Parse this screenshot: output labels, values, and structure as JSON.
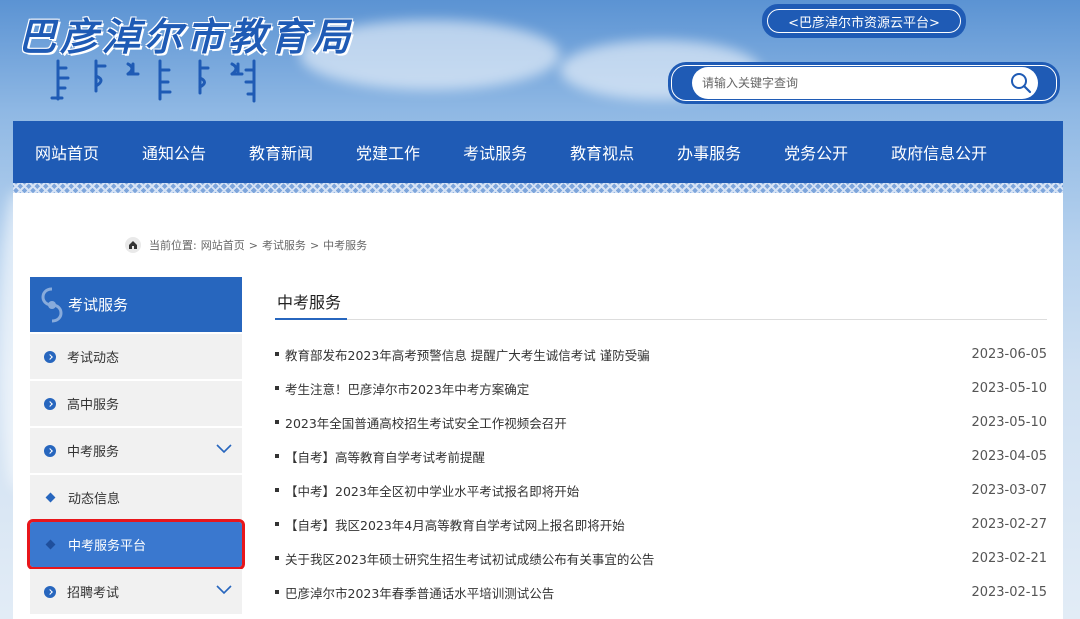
{
  "header": {
    "site_title": "巴彦淖尔市教育局",
    "cloud_platform_link": "<巴彦淖尔市资源云平台>",
    "search": {
      "placeholder": "请输入关键字查询"
    }
  },
  "nav": {
    "items": [
      "网站首页",
      "通知公告",
      "教育新闻",
      "党建工作",
      "考试服务",
      "教育视点",
      "办事服务",
      "党务公开",
      "政府信息公开"
    ]
  },
  "breadcrumb": {
    "prefix": "当前位置:",
    "items": [
      "网站首页",
      "考试服务",
      "中考服务"
    ],
    "separator": ">"
  },
  "sidebar": {
    "heading": "考试服务",
    "items": [
      {
        "label": "考试动态"
      },
      {
        "label": "高中服务"
      },
      {
        "label": "中考服务"
      },
      {
        "label": "动态信息"
      },
      {
        "label": "中考服务平台"
      },
      {
        "label": "招聘考试"
      }
    ]
  },
  "main": {
    "title": "中考服务",
    "news": [
      {
        "title": "教育部发布2023年高考预警信息 提醒广大考生诚信考试 谨防受骗",
        "date": "2023-06-05"
      },
      {
        "title": "考生注意！巴彦淖尔市2023年中考方案确定",
        "date": "2023-05-10"
      },
      {
        "title": "2023年全国普通高校招生考试安全工作视频会召开",
        "date": "2023-05-10"
      },
      {
        "title": "【自考】高等教育自学考试考前提醒",
        "date": "2023-04-05"
      },
      {
        "title": "【中考】2023年全区初中学业水平考试报名即将开始",
        "date": "2023-03-07"
      },
      {
        "title": "【自考】我区2023年4月高等教育自学考试网上报名即将开始",
        "date": "2023-02-27"
      },
      {
        "title": "关于我区2023年硕士研究生招生考试初试成绩公布有关事宜的公告",
        "date": "2023-02-21"
      },
      {
        "title": "巴彦淖尔市2023年春季普通话水平培训测试公告",
        "date": "2023-02-15"
      }
    ]
  }
}
